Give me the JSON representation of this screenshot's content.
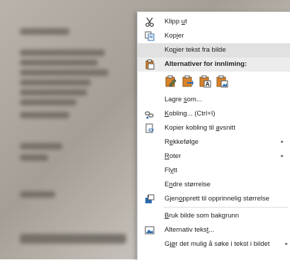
{
  "menu": {
    "items": [
      {
        "pre": "Klipp ",
        "u": "u",
        "post": "t",
        "icon": "scissors-icon"
      },
      {
        "pre": "Kop",
        "u": "i",
        "post": "er",
        "icon": "copy-icon"
      },
      {
        "pre": "Ko",
        "u": "p",
        "post": "ier tekst fra bilde",
        "icon": ""
      },
      {
        "pre": "Alternativer for innliming:",
        "u": "",
        "post": "",
        "icon": "clipboard-icon"
      },
      {
        "pre": "Lagre ",
        "u": "s",
        "post": "om...",
        "icon": ""
      },
      {
        "pre": "",
        "u": "K",
        "post": "obling...  (Ctrl+I)",
        "icon": "link-icon"
      },
      {
        "pre": "Kopier kobling til ",
        "u": "a",
        "post": "vsnitt",
        "icon": "copy-link-icon"
      },
      {
        "pre": "R",
        "u": "e",
        "post": "kkefølge",
        "icon": ""
      },
      {
        "pre": "",
        "u": "R",
        "post": "oter",
        "icon": ""
      },
      {
        "pre": "Fl",
        "u": "y",
        "post": "tt",
        "icon": ""
      },
      {
        "pre": "E",
        "u": "n",
        "post": "dre størrelse",
        "icon": ""
      },
      {
        "pre": "Gjen",
        "u": "o",
        "post": "pprett til opprinnelig størrelse",
        "icon": "reset-size-icon"
      },
      {
        "pre": "",
        "u": "B",
        "post": "ruk bilde som bakgrunn",
        "icon": ""
      },
      {
        "pre": "Alternativ teks",
        "u": "t",
        "post": "...",
        "icon": "alt-text-icon"
      },
      {
        "pre": "Gj",
        "u": "ø",
        "post": "r det mulig å søke i tekst i bildet",
        "icon": ""
      }
    ],
    "paste_options": [
      "paste-keep-formatting-icon",
      "paste-merge-formatting-icon",
      "paste-text-only-icon",
      "paste-picture-icon"
    ],
    "submenu_arrow": "▸"
  },
  "colors": {
    "accent": "#d9822b",
    "blue": "#2b6cb0",
    "highlight": "#e1e1e1"
  }
}
